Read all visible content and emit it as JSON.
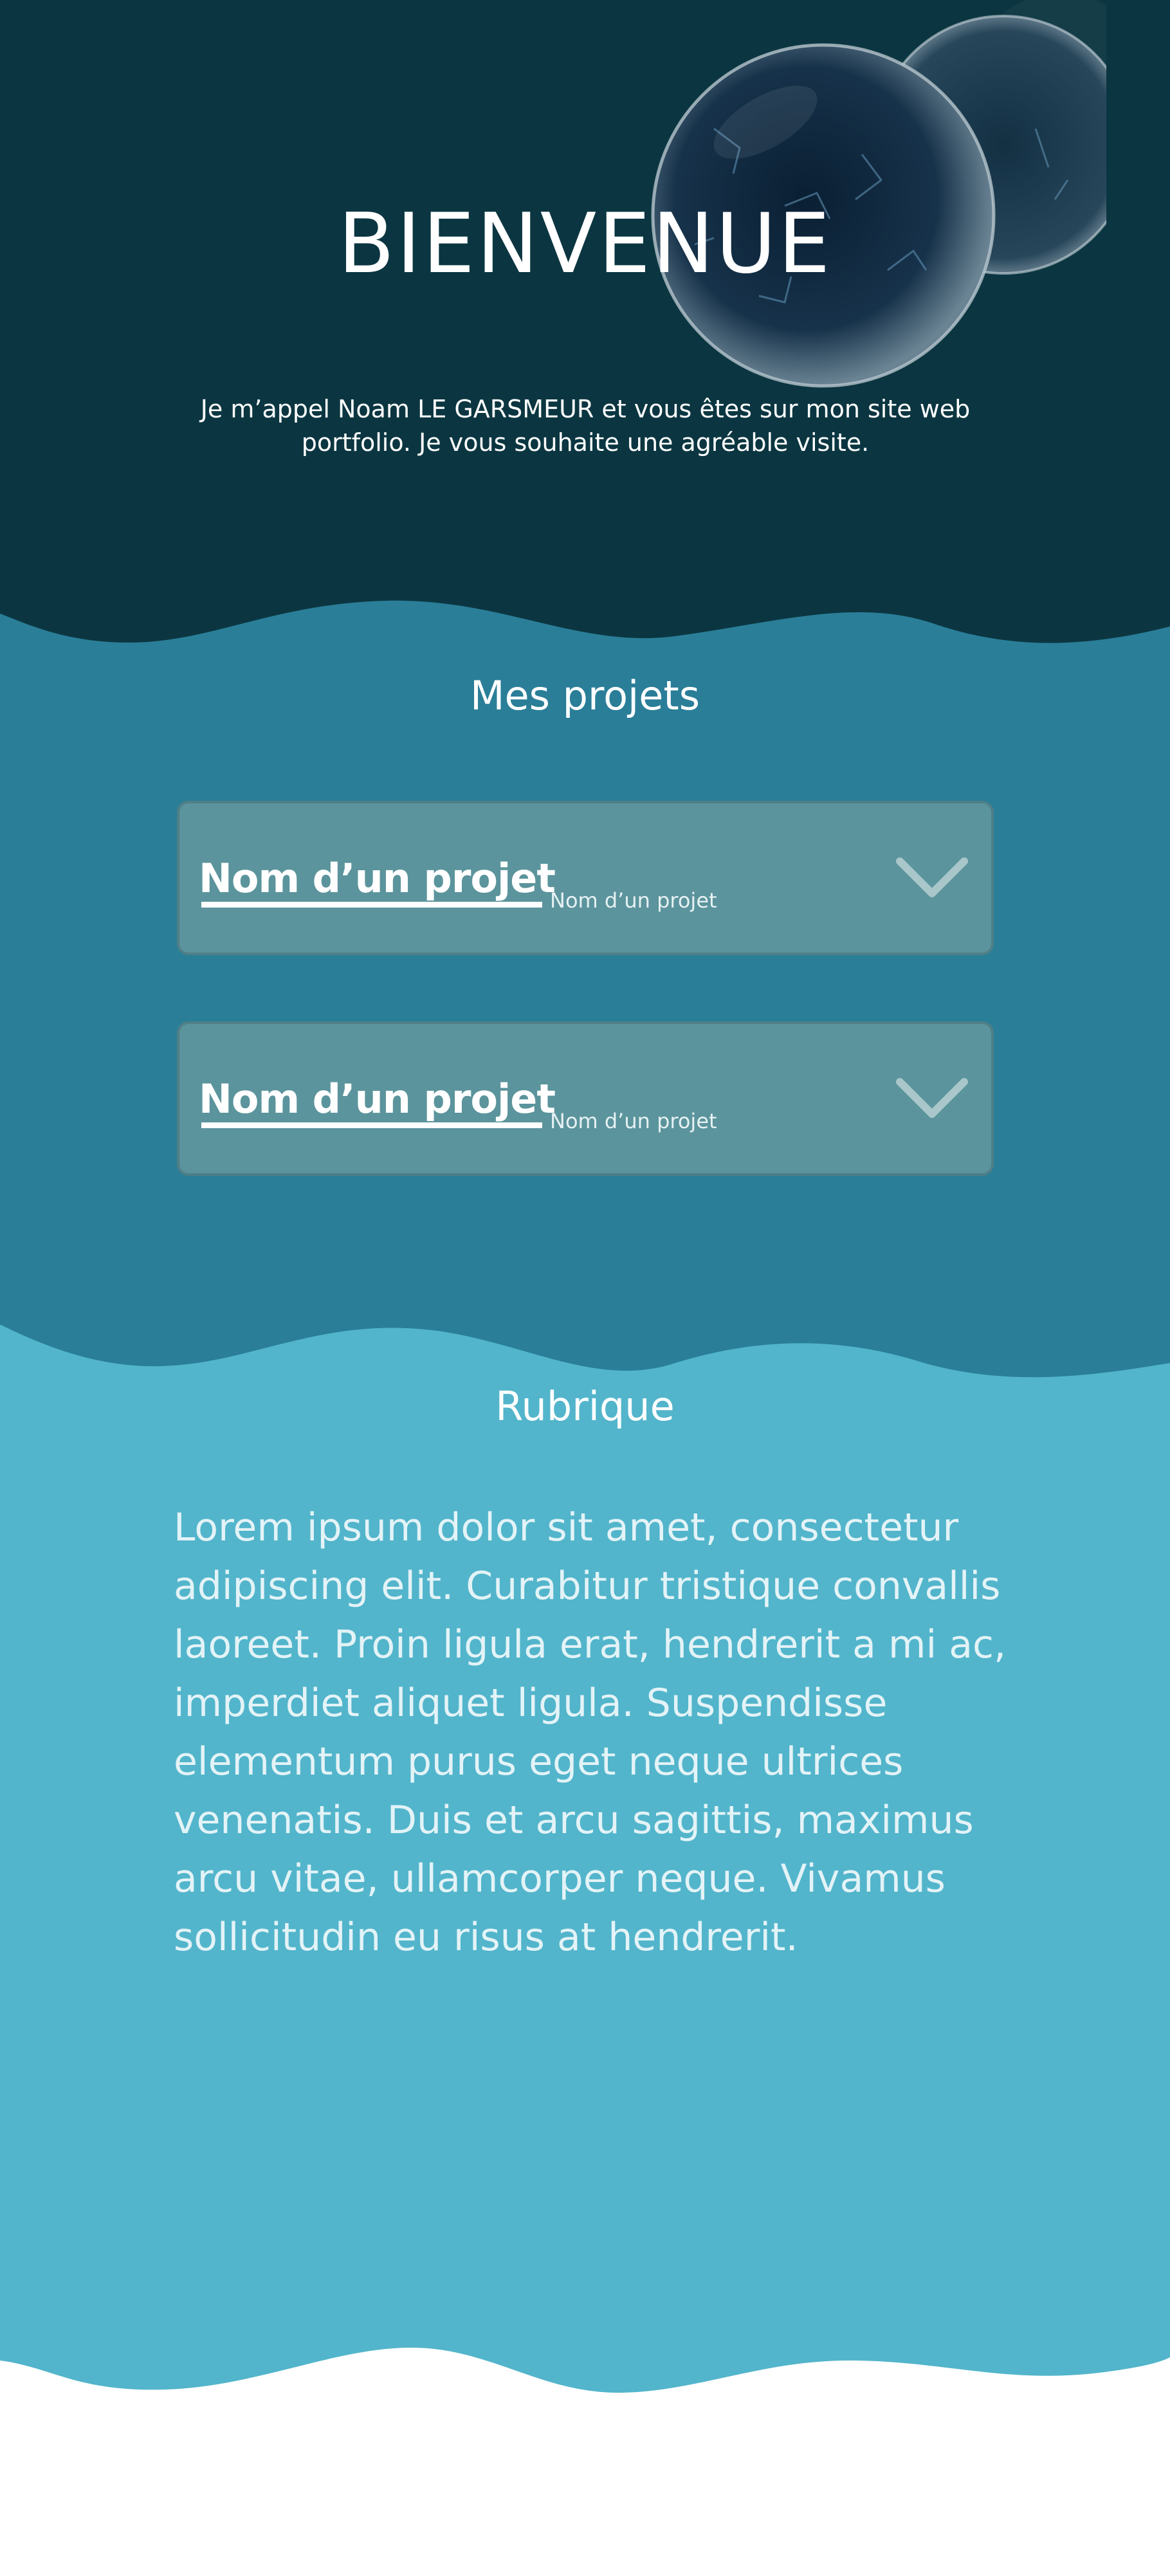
{
  "hero": {
    "title": "BIENVENUE",
    "intro": "Je m’appel Noam LE GARSMEUR et vous êtes sur mon site web portfolio. Je vous souhaite une agréable visite."
  },
  "projects": {
    "title": "Mes projets",
    "items": [
      {
        "name": "Nom d’un projet",
        "subtitle": "Nom d’un projet",
        "icon": "chevron-down-icon"
      },
      {
        "name": "Nom d’un projet",
        "subtitle": "Nom d’un projet",
        "icon": "chevron-down-icon"
      }
    ]
  },
  "rubrique": {
    "title": "Rubrique",
    "body": "Lorem ipsum dolor sit amet, consectetur adipiscing elit. Curabitur tristique convallis laoreet. Proin ligula erat, hendrerit a mi ac, imperdiet aliquet ligula. Suspendisse elementum purus eget neque ultrices venenatis. Duis et arcu sagittis, maximus arcu vitae, ullamcorper neque. Vivamus sollicitudin eu risus at hendrerit."
  },
  "colors": {
    "hero_bg": "#0b3641",
    "projects_bg": "#2a7e98",
    "rubrique_bg": "#52b5cb",
    "card_bg": "#5b949c",
    "text": "#ffffff"
  }
}
